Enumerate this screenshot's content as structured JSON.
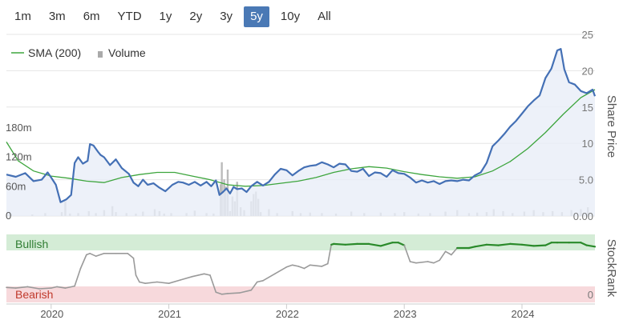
{
  "range_selector": {
    "buttons": [
      "1m",
      "3m",
      "6m",
      "YTD",
      "1y",
      "2y",
      "3y",
      "5y",
      "10y",
      "All"
    ],
    "selected": "5y"
  },
  "colors": {
    "price": "#4470b5",
    "sma": "#3da53d",
    "volume": "#bbbbbb",
    "stockrank_line": "#9a9a9a",
    "stockrank_bullish_line": "#2a8a2a",
    "bullish_band": "#d4ecd6",
    "bearish_band": "#f7d9dc",
    "price_area": "#e8eef7"
  },
  "chart_data": [
    {
      "type": "line",
      "legend": {
        "position": "top-left",
        "items": [
          "SMA (200)",
          "Volume"
        ]
      },
      "x_ticks": [
        "2020",
        "2021",
        "2022",
        "2023",
        "2024"
      ],
      "x_range": [
        2019.62,
        2024.62
      ],
      "price_axis": {
        "label": "Share Price",
        "ticks": [
          "25",
          "20",
          "15",
          "10",
          "5.0",
          "0.00"
        ],
        "tick_values": [
          25,
          20,
          15,
          10,
          5,
          0
        ],
        "range": [
          0,
          25
        ]
      },
      "volume_axis": {
        "ticks": [
          "180m",
          "120m",
          "60m",
          "0"
        ],
        "tick_values": [
          180,
          120,
          60,
          0
        ],
        "range": [
          0,
          180
        ]
      },
      "series": [
        {
          "name": "Share Price",
          "x": [
            2019.62,
            2019.7,
            2019.78,
            2019.85,
            2019.92,
            2019.97,
            2020.0,
            2020.04,
            2020.08,
            2020.13,
            2020.17,
            2020.2,
            2020.23,
            2020.27,
            2020.31,
            2020.33,
            2020.36,
            2020.4,
            2020.42,
            2020.45,
            2020.5,
            2020.55,
            2020.6,
            2020.66,
            2020.7,
            2020.74,
            2020.78,
            2020.82,
            2020.87,
            2020.92,
            2020.97,
            2021.03,
            2021.08,
            2021.12,
            2021.17,
            2021.22,
            2021.27,
            2021.32,
            2021.36,
            2021.4,
            2021.43,
            2021.46,
            2021.49,
            2021.52,
            2021.55,
            2021.58,
            2021.62,
            2021.66,
            2021.7,
            2021.75,
            2021.8,
            2021.85,
            2021.9,
            2021.95,
            2022.0,
            2022.05,
            2022.1,
            2022.15,
            2022.2,
            2022.25,
            2022.3,
            2022.35,
            2022.4,
            2022.45,
            2022.5,
            2022.55,
            2022.6,
            2022.65,
            2022.7,
            2022.75,
            2022.8,
            2022.85,
            2022.9,
            2022.95,
            2023.0,
            2023.05,
            2023.1,
            2023.15,
            2023.2,
            2023.25,
            2023.3,
            2023.35,
            2023.4,
            2023.45,
            2023.5,
            2023.55,
            2023.6,
            2023.65,
            2023.7,
            2023.75,
            2023.8,
            2023.85,
            2023.9,
            2023.95,
            2024.0,
            2024.05,
            2024.1,
            2024.15,
            2024.2,
            2024.25,
            2024.3,
            2024.33,
            2024.36,
            2024.4,
            2024.45,
            2024.5,
            2024.55,
            2024.6,
            2024.62
          ],
          "values": [
            5.7,
            5.4,
            5.9,
            4.8,
            5.0,
            6.0,
            5.3,
            4.3,
            1.9,
            2.3,
            2.9,
            7.3,
            8.1,
            7.2,
            7.6,
            9.9,
            9.7,
            8.8,
            8.4,
            8.1,
            7.0,
            7.8,
            6.6,
            5.8,
            4.6,
            4.1,
            5.0,
            4.3,
            4.5,
            3.9,
            3.4,
            4.3,
            4.7,
            4.6,
            4.3,
            4.7,
            4.2,
            4.7,
            4.1,
            4.9,
            2.9,
            3.3,
            3.8,
            3.1,
            4.0,
            3.7,
            3.8,
            3.3,
            4.1,
            4.7,
            4.2,
            4.7,
            5.7,
            6.5,
            6.3,
            5.6,
            6.2,
            6.7,
            6.9,
            7.0,
            7.4,
            7.1,
            6.7,
            7.2,
            7.1,
            6.2,
            6.1,
            6.5,
            5.5,
            6.0,
            5.9,
            5.4,
            6.3,
            5.9,
            5.8,
            5.3,
            4.6,
            4.9,
            4.6,
            4.8,
            4.4,
            4.8,
            4.9,
            4.8,
            5.0,
            4.9,
            5.6,
            6.0,
            7.3,
            9.6,
            10.4,
            11.3,
            12.3,
            13.1,
            14.1,
            15.1,
            15.9,
            16.6,
            19.0,
            20.3,
            22.8,
            23.0,
            20.2,
            18.4,
            18.1,
            17.2,
            16.9,
            17.4,
            16.5
          ]
        },
        {
          "name": "SMA (200)",
          "x": [
            2019.62,
            2019.72,
            2019.85,
            2020.0,
            2020.15,
            2020.3,
            2020.45,
            2020.6,
            2020.75,
            2020.9,
            2021.05,
            2021.2,
            2021.35,
            2021.5,
            2021.65,
            2021.8,
            2021.95,
            2022.1,
            2022.25,
            2022.4,
            2022.55,
            2022.7,
            2022.85,
            2023.0,
            2023.15,
            2023.3,
            2023.45,
            2023.6,
            2023.75,
            2023.9,
            2024.05,
            2024.2,
            2024.35,
            2024.5,
            2024.62
          ],
          "values": [
            10.2,
            7.6,
            6.2,
            5.5,
            5.2,
            4.8,
            4.6,
            5.3,
            5.7,
            6.0,
            6.0,
            5.5,
            5.0,
            4.3,
            4.1,
            4.2,
            4.5,
            4.8,
            5.3,
            6.0,
            6.5,
            6.8,
            6.6,
            6.1,
            5.7,
            5.4,
            5.2,
            5.4,
            6.2,
            7.5,
            9.3,
            11.5,
            14.0,
            16.3,
            17.4
          ]
        },
        {
          "name": "Volume",
          "x": [
            2019.66,
            2019.84,
            2019.95,
            2020.09,
            2020.12,
            2020.16,
            2020.23,
            2020.32,
            2020.38,
            2020.45,
            2020.52,
            2020.55,
            2020.64,
            2020.72,
            2020.78,
            2020.88,
            2020.92,
            2020.96,
            2021.02,
            2021.15,
            2021.22,
            2021.32,
            2021.38,
            2021.44,
            2021.45,
            2021.47,
            2021.48,
            2021.5,
            2021.52,
            2021.54,
            2021.56,
            2021.58,
            2021.61,
            2021.64,
            2021.7,
            2021.72,
            2021.74,
            2021.76,
            2021.78,
            2021.85,
            2021.92,
            2022.05,
            2022.12,
            2022.2,
            2022.3,
            2022.42,
            2022.55,
            2022.66,
            2022.8,
            2022.92,
            2023.0,
            2023.12,
            2023.22,
            2023.35,
            2023.45,
            2023.55,
            2023.62,
            2023.7,
            2023.76,
            2023.84,
            2023.92,
            2024.02,
            2024.1,
            2024.18,
            2024.26,
            2024.34,
            2024.42,
            2024.5,
            2024.56
          ],
          "values": [
            4,
            3,
            6,
            8,
            30,
            5,
            6,
            10,
            6,
            12,
            20,
            8,
            6,
            5,
            9,
            14,
            10,
            5,
            6,
            6,
            11,
            6,
            5,
            65,
            110,
            75,
            60,
            95,
            10,
            40,
            30,
            70,
            18,
            12,
            30,
            45,
            50,
            35,
            8,
            14,
            6,
            10,
            6,
            7,
            6,
            5,
            9,
            6,
            7,
            6,
            8,
            5,
            6,
            9,
            12,
            6,
            7,
            8,
            14,
            10,
            6,
            9,
            12,
            8,
            10,
            8,
            12,
            14,
            18
          ]
        }
      ]
    },
    {
      "type": "line",
      "band_labels": {
        "bullish": "Bullish",
        "bearish": "Bearish"
      },
      "y_axis": {
        "label": "StockRank",
        "ticks": [
          "0"
        ],
        "range": [
          0,
          100
        ]
      },
      "x_ticks": [
        "2020",
        "2021",
        "2022",
        "2023",
        "2024"
      ],
      "series": [
        {
          "name": "StockRank",
          "x": [
            2019.62,
            2019.7,
            2019.8,
            2019.9,
            2020.0,
            2020.05,
            2020.12,
            2020.2,
            2020.25,
            2020.3,
            2020.33,
            2020.38,
            2020.45,
            2020.55,
            2020.65,
            2020.7,
            2020.72,
            2020.75,
            2020.8,
            2020.9,
            2021.0,
            2021.1,
            2021.2,
            2021.3,
            2021.35,
            2021.4,
            2021.45,
            2021.5,
            2021.6,
            2021.7,
            2021.75,
            2021.8,
            2021.9,
            2022.0,
            2022.05,
            2022.1,
            2022.15,
            2022.2,
            2022.3,
            2022.35,
            2022.38,
            2022.4,
            2022.5,
            2022.6,
            2022.7,
            2022.8,
            2022.9,
            2022.95,
            2023.0,
            2023.05,
            2023.1,
            2023.2,
            2023.25,
            2023.3,
            2023.35,
            2023.4,
            2023.45,
            2023.55,
            2023.6,
            2023.7,
            2023.8,
            2023.9,
            2024.0,
            2024.1,
            2024.2,
            2024.25,
            2024.3,
            2024.4,
            2024.5,
            2024.55,
            2024.62
          ],
          "values": [
            22,
            21,
            23,
            20,
            21,
            23,
            21,
            24,
            50,
            70,
            72,
            68,
            72,
            72,
            72,
            65,
            40,
            30,
            28,
            30,
            28,
            33,
            38,
            42,
            40,
            15,
            12,
            13,
            14,
            18,
            30,
            32,
            42,
            52,
            55,
            53,
            50,
            55,
            53,
            57,
            85,
            86,
            85,
            86,
            86,
            83,
            88,
            88,
            84,
            60,
            58,
            60,
            58,
            62,
            75,
            70,
            80,
            80,
            82,
            85,
            84,
            86,
            85,
            83,
            84,
            88,
            88,
            88,
            88,
            84,
            82
          ]
        }
      ]
    }
  ]
}
